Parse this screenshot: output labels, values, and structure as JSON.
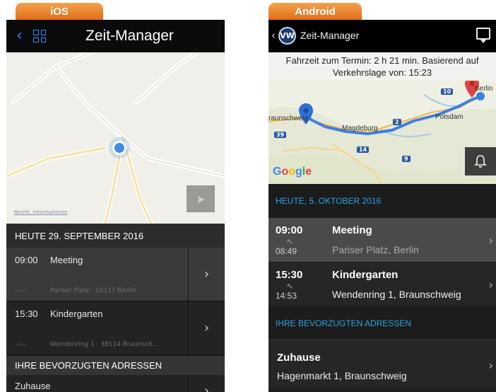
{
  "ios": {
    "tag": "iOS",
    "nav": {
      "back_icon": "‹",
      "title": "Zeit-Manager"
    },
    "map": {
      "legal_link": "Rechtl. Informationen",
      "location_button_icon": "navigation-arrow-icon"
    },
    "section_today": "HEUTE 29. SEPTEMBER 2016",
    "appointments": [
      {
        "time": "09:00",
        "title": "Meeting",
        "departure": "--:--",
        "address": "Pariser Platz · 10117 Berlin"
      },
      {
        "time": "15:30",
        "title": "Kindergarten",
        "departure": "--:--",
        "address": "Wendenring 1 · 38114 Braunsch..."
      }
    ],
    "section_favorites": "IHRE BEVORZUGTEN ADRESSEN",
    "favorites": [
      {
        "title": "Zuhause"
      }
    ],
    "chevron": "›"
  },
  "android": {
    "tag": "Android",
    "bar": {
      "back_icon": "‹",
      "logo_text": "VW",
      "title": "Zeit-Manager"
    },
    "travel_info": {
      "line1": "Fahrzeit zum Termin: 2 h 21 min. Basierend auf",
      "line2": "Verkehrslage von: 15:23"
    },
    "map": {
      "google": [
        "G",
        "o",
        "o",
        "g",
        "l",
        "e"
      ],
      "google_colors": [
        "#4285f4",
        "#ea4335",
        "#fbbc05",
        "#4285f4",
        "#34a853",
        "#ea4335"
      ],
      "cities": [
        "raunschweig",
        "Magdeburg",
        "Potsdam",
        "Berlin"
      ],
      "road_badges": [
        "10",
        "2",
        "14",
        "9",
        "39"
      ],
      "bell_icon": "bell-icon"
    },
    "section_today": "HEUTE, 5. OKTOBER 2016",
    "appointments": [
      {
        "time": "09:00",
        "title": "Meeting",
        "departure": "08:49",
        "address": "Pariser Platz, Berlin"
      },
      {
        "time": "15:30",
        "title": "Kindergarten",
        "departure": "14:53",
        "address": "Wendenring 1, Braunschweig"
      }
    ],
    "car_glyph": "⛍",
    "section_favorites": "IHRE BEVORZUGTEN ADRESSEN",
    "favorites": [
      {
        "title": "Zuhause",
        "address": "Hagenmarkt 1, Braunschweig"
      }
    ],
    "chevron": "›"
  }
}
